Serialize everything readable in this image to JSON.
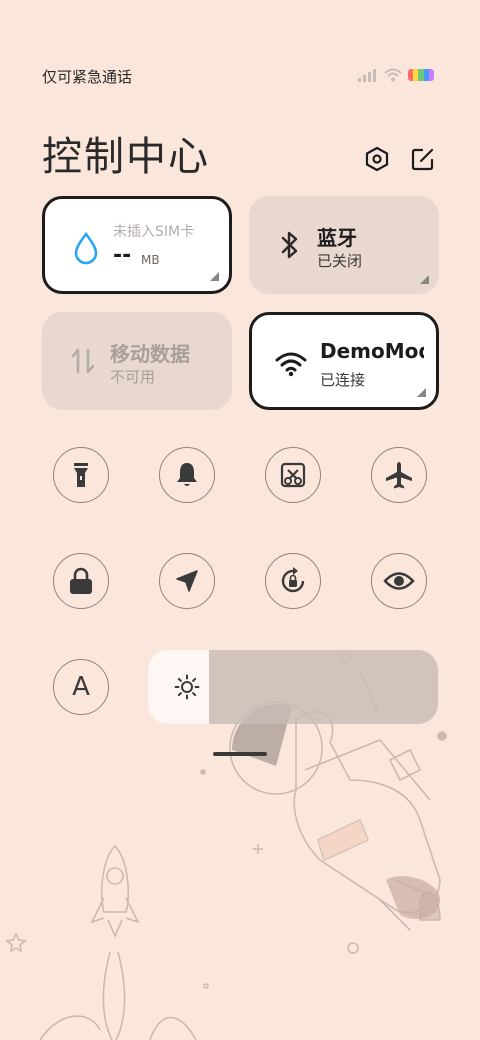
{
  "status_bar": {
    "carrier_text": "仅可紧急通话",
    "battery_colors": [
      "#ff6b6b",
      "#ffd93d",
      "#6bcB77",
      "#4d96ff",
      "#c77dff"
    ]
  },
  "header": {
    "title": "控制中心",
    "settings_icon": "hexagon-settings-icon",
    "edit_icon": "edit-icon"
  },
  "tiles": {
    "data_usage": {
      "label": "未插入SIM卡",
      "value": "--",
      "unit": "MB",
      "icon": "water-drop-icon"
    },
    "bluetooth": {
      "label": "蓝牙",
      "status": "已关闭",
      "icon": "bluetooth-icon"
    },
    "mobile_data": {
      "label": "移动数据",
      "status": "不可用",
      "icon": "data-transfer-icon"
    },
    "wifi": {
      "label": "DemoMode",
      "status": "已连接",
      "icon": "wifi-icon"
    }
  },
  "toggles": [
    {
      "name": "flashlight",
      "icon": "flashlight-icon"
    },
    {
      "name": "ringer",
      "icon": "bell-icon"
    },
    {
      "name": "screenshot",
      "icon": "screenshot-icon"
    },
    {
      "name": "airplane",
      "icon": "airplane-icon"
    },
    {
      "name": "lock-screen",
      "icon": "lock-icon"
    },
    {
      "name": "location",
      "icon": "location-arrow-icon"
    },
    {
      "name": "auto-rotate",
      "icon": "rotate-lock-icon"
    },
    {
      "name": "reading-mode",
      "icon": "eye-icon"
    },
    {
      "name": "font-size",
      "icon": "letter-a-icon",
      "glyph": "A"
    }
  ],
  "brightness": {
    "level": 0.21,
    "icon": "sun-icon"
  },
  "colors": {
    "background": "#fbe6dc",
    "tile_active_border": "#1c1c1c",
    "tile_inactive": "#e8d8cf",
    "drop_blue": "#2aa4f4"
  }
}
